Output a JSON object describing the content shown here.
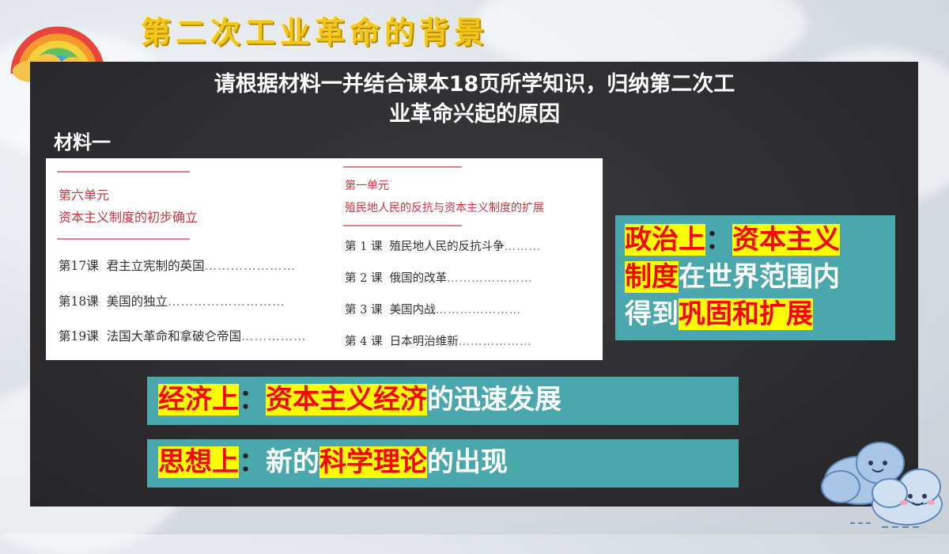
{
  "title": "第二次工业革命的背景",
  "question": {
    "line1": "请根据材料一并结合课本18页所学知识，归纳第二次工",
    "line2": "业革命兴起的原因"
  },
  "material_label": "材料一",
  "textbook": {
    "left": {
      "unit": "第六单元",
      "unit_title": "资本主义制度的初步确立",
      "lessons": [
        {
          "num": "第17课",
          "title": "君主立宪制的英国"
        },
        {
          "num": "第18课",
          "title": "美国的独立"
        },
        {
          "num": "第19课",
          "title": "法国大革命和拿破仑帝国"
        }
      ]
    },
    "right": {
      "unit": "第一单元",
      "unit_title": "殖民地人民的反抗与资本主义制度的扩展",
      "lessons": [
        {
          "num": "第 1 课",
          "title": "殖民地人民的反抗斗争"
        },
        {
          "num": "第 2 课",
          "title": "俄国的改革"
        },
        {
          "num": "第 3 课",
          "title": "美国内战"
        },
        {
          "num": "第 4 课",
          "title": "日本明治维新"
        }
      ]
    }
  },
  "political": {
    "label": "政治上",
    "colon": "：",
    "hl1": "资本主义",
    "hl2": "制度",
    "text1": "在世界范围内",
    "text2": "得到",
    "hl3": "巩固和扩展"
  },
  "economic": {
    "label": "经济上",
    "colon": "：",
    "hl": "资本主义经济",
    "text": "的迅速发展"
  },
  "thought": {
    "label": "思想上",
    "colon": "：",
    "text1": "新的",
    "hl": "科学理论",
    "text2": "的出现"
  },
  "colors": {
    "panel": "#4aa8ad",
    "highlight": "#ffff00",
    "red": "#ff0000",
    "title": "#f2c718",
    "board": "#2f2f31"
  }
}
